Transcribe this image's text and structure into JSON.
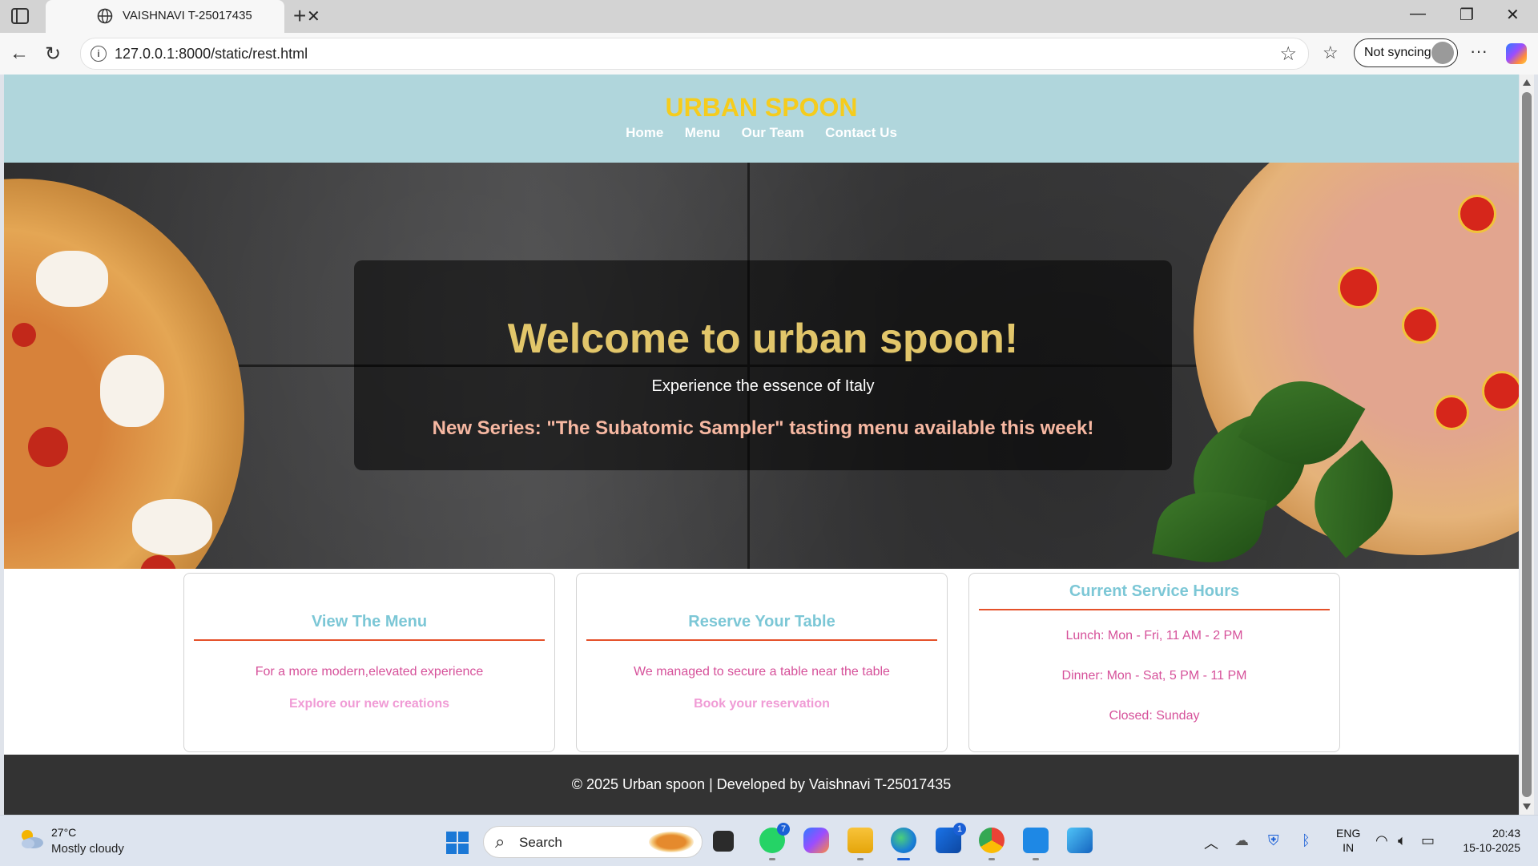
{
  "browser": {
    "tab_title": "VAISHNAVI T-25017435",
    "url": "127.0.0.1:8000/static/rest.html",
    "sync_label": "Not syncing",
    "new_tab_glyph": "+",
    "close_tab_glyph": "✕"
  },
  "site": {
    "brand": "URBAN SPOON",
    "nav": [
      "Home",
      "Menu",
      "Our Team",
      "Contact Us"
    ],
    "hero": {
      "title": "Welcome to urban spoon!",
      "subtitle": "Experience the essence of Italy",
      "promo": "New Series: \"The Subatomic Sampler\" tasting menu available this week!"
    },
    "cards": [
      {
        "title": "View The Menu",
        "text": "For a more modern,elevated experience",
        "link": "Explore our new creations"
      },
      {
        "title": "Reserve Your Table",
        "text": "We managed to secure a table near the table",
        "link": "Book your reservation"
      },
      {
        "title": "Current Service Hours",
        "lines": [
          "Lunch: Mon - Fri, 11 AM - 2 PM",
          "Dinner: Mon - Sat, 5 PM - 11 PM",
          "Closed: Sunday"
        ]
      }
    ],
    "footer": "© 2025 Urban spoon | Developed by Vaishnavi T-25017435",
    "colors": {
      "header_bg": "#b0d6dc",
      "brand": "#f5cc1d",
      "hero_title": "#e2c66a",
      "promo": "#f7b8a2",
      "card_title": "#7cc7d6",
      "card_rule": "#e5512a",
      "card_text": "#d6519a",
      "card_link": "#f09bd5",
      "footer_bg": "#333333"
    }
  },
  "taskbar": {
    "temperature": "27°C",
    "condition": "Mostly cloudy",
    "search_label": "Search",
    "whatsapp_badge": "7",
    "store_badge": "1",
    "lang_line1": "ENG",
    "lang_line2": "IN",
    "time": "20:43",
    "date": "15-10-2025"
  },
  "icons": [
    "tab-actions-icon",
    "globe-icon",
    "back-icon",
    "refresh-icon",
    "info-icon",
    "star-icon",
    "favorites-icon",
    "more-icon",
    "copilot-icon",
    "weather-icon",
    "windows-start-icon",
    "search-icon",
    "task-view-icon",
    "whatsapp-icon",
    "copilot-app-icon",
    "file-explorer-icon",
    "edge-icon",
    "store-icon",
    "chrome-icon",
    "vscode-icon",
    "paint-icon",
    "tray-chevron-icon",
    "onedrive-icon",
    "defender-icon",
    "bluetooth-icon",
    "wifi-icon",
    "volume-icon",
    "battery-icon"
  ]
}
